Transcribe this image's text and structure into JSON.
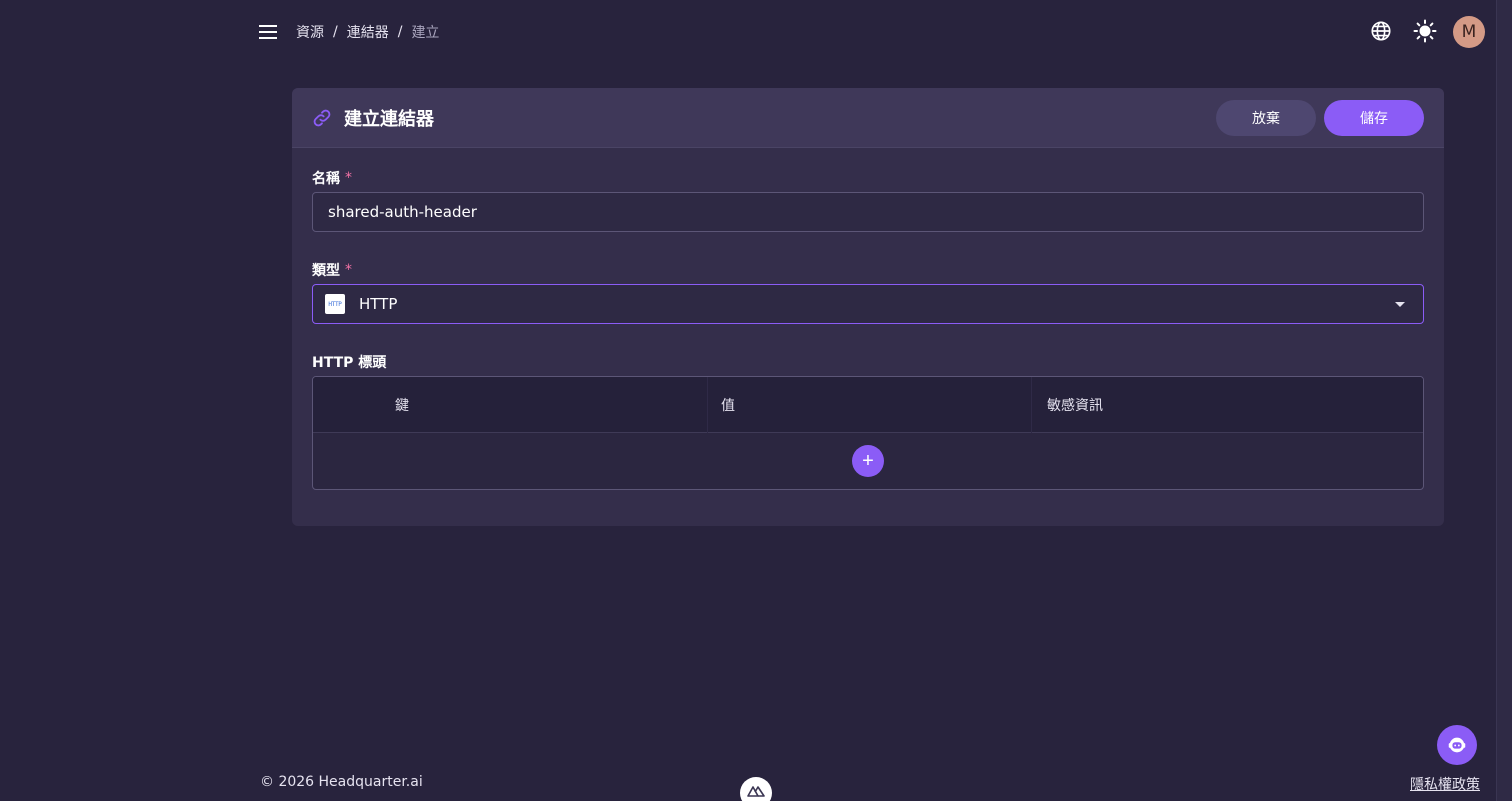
{
  "header": {
    "breadcrumb": [
      "資源",
      "連結器",
      "建立"
    ],
    "breadcrumb_sep": "/",
    "avatar_initial": "M"
  },
  "card": {
    "title": "建立連結器",
    "cancel_label": "放棄",
    "save_label": "儲存"
  },
  "form": {
    "name_label": "名稱",
    "name_value": "shared-auth-header",
    "type_label": "類型",
    "type_value": "HTTP",
    "type_badge": "HTTP",
    "headers_label": "HTTP 標頭",
    "required_mark": "*",
    "columns": [
      "鍵",
      "值",
      "敏感資訊"
    ],
    "add_label": "+"
  },
  "footer": {
    "copyright": "© 2026 Headquarter.ai",
    "privacy": "隱私權政策"
  },
  "colors": {
    "background": "#28233d",
    "card": "#342e4b",
    "accent": "#8b5cf6",
    "required": "#f472a6"
  },
  "icons": [
    "menu-icon",
    "globe-icon",
    "sun-icon",
    "link-icon",
    "http-icon",
    "chevron-down-icon",
    "plus-icon",
    "nuxt-icon",
    "chat-bot-icon"
  ]
}
